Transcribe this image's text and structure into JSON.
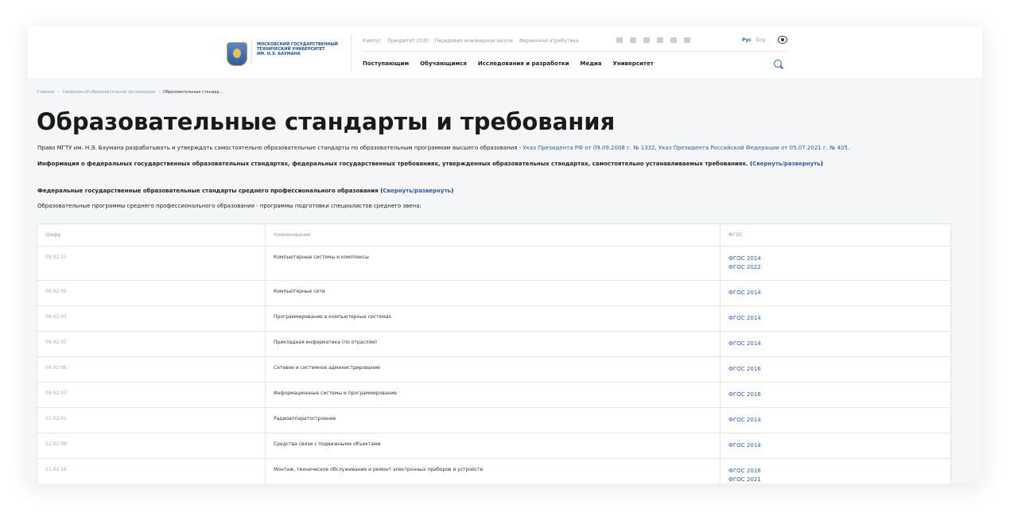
{
  "header": {
    "logo_text": [
      "МОСКОВСКИЙ ГОСУДАРСТВЕННЫЙ",
      "ТЕХНИЧЕСКИЙ УНИВЕРСИТЕТ",
      "ИМ. Н.Э. БАУМАНА"
    ],
    "top_links": [
      "Кампус",
      "Приоритет 2030",
      "Передовая инженерная школа",
      "Фирменная атрибутика"
    ],
    "social_icons": [
      "youtube-icon",
      "vk-icon",
      "telegram-icon",
      "rutube-icon",
      "ok-icon",
      "dzen-icon"
    ],
    "lang_active": "Рус",
    "lang_other": "Eng",
    "main_nav": [
      "Поступающим",
      "Обучающимся",
      "Исследования и разработки",
      "Медиа",
      "Университет"
    ]
  },
  "breadcrumb": {
    "home": "Главная",
    "sep": "›",
    "section": "Сведения об образовательной организации",
    "current": "Образовательные стандар..."
  },
  "page": {
    "title": "Образовательные стандарты и требования",
    "p1_text": "Право МГТУ им. Н.Э. Баумана разрабатывать и утверждать самостоятельно образовательные стандарты по образовательным программам высшего образования - ",
    "p1_link1": "Указ Президента РФ от 09.09.2008 г. № 1332",
    "p1_sep": ", ",
    "p1_link2": "Указ Президента Российской Федерации от 05.07.2021 г. № 405",
    "p1_end": ".",
    "p2_text": "Информация о федеральных государственных образовательных стандартах, федеральных государственных требованиях, утвержденных образовательных стандартах, самостоятельно устанавливаемых требованиях. (",
    "p2_link": "Свернуть/развернуть",
    "p2_end": ")",
    "p3_text": "Федеральные государственные образовательные стандарты среднего профессионального образования (",
    "p3_link": "Свернуть/развернуть",
    "p3_end": ")",
    "p4_text": "Образовательные программы среднего профессионального образования - программы подготовки специалистов среднего звена:"
  },
  "table": {
    "headers": [
      "Шифр",
      "Наименование",
      "ФГОС"
    ],
    "rows": [
      {
        "code": "09.02.01",
        "name": "Компьютерные системы и комплексы",
        "links": [
          "ФГОС 2014",
          "ФГОС 2022"
        ]
      },
      {
        "code": "09.02.02",
        "name": "Компьютерные сети",
        "links": [
          "ФГОС 2014"
        ]
      },
      {
        "code": "09.02.03",
        "name": "Программирование в компьютерных системах",
        "links": [
          "ФГОС 2014"
        ]
      },
      {
        "code": "09.02.05",
        "name": "Прикладная информатика (по отраслям)",
        "links": [
          "ФГОС 2014"
        ]
      },
      {
        "code": "09.02.06",
        "name": "Сетевое и системное администрирование",
        "links": [
          "ФГОС 2016"
        ]
      },
      {
        "code": "09.02.07",
        "name": "Информационные системы и программирование",
        "links": [
          "ФГОС 2016"
        ]
      },
      {
        "code": "11.02.01",
        "name": "Радиоаппаратостроение",
        "links": [
          "ФГОС 2014"
        ]
      },
      {
        "code": "11.02.08",
        "name": "Средства связи с подвижными объектами",
        "links": [
          "ФГОС 2014"
        ]
      },
      {
        "code": "11.02.16",
        "name": "Монтаж, техническое обслуживание и ремонт электронных приборов и устройств",
        "links": [
          "ФГОС 2016",
          "ФГОС 2021"
        ]
      }
    ]
  }
}
